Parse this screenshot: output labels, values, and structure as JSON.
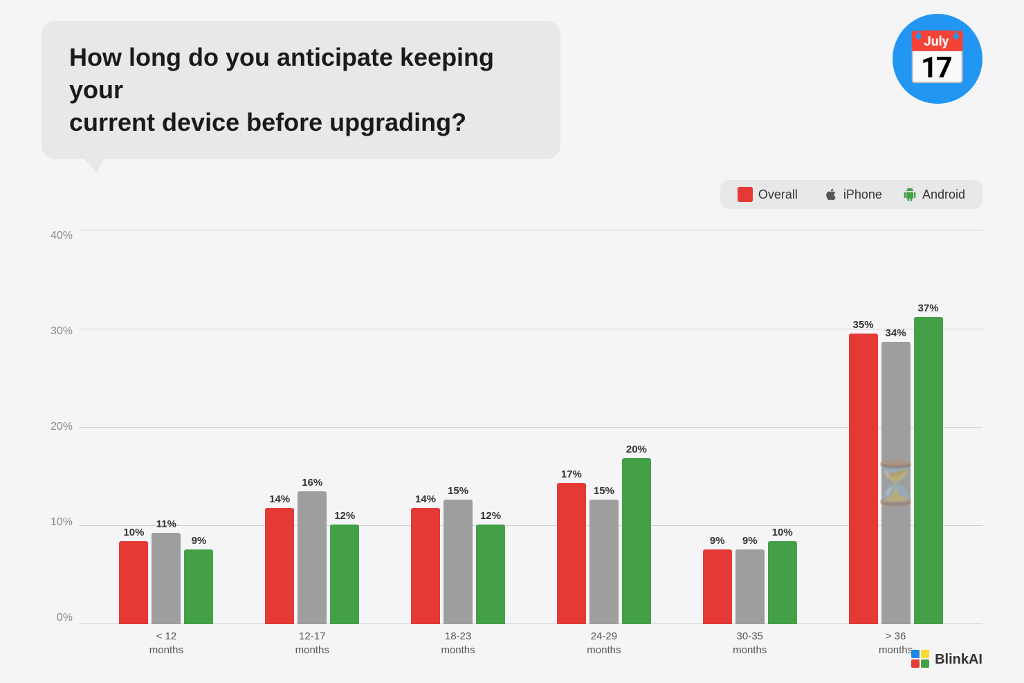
{
  "question": "How long do you anticipate keeping your\ncurrent device before upgrading?",
  "legend": {
    "items": [
      {
        "label": "Overall",
        "color": "#e53935",
        "icon": "square",
        "type": "color"
      },
      {
        "label": "iPhone",
        "color": "#9e9e9e",
        "icon": "apple",
        "type": "icon"
      },
      {
        "label": "Android",
        "color": "#43a047",
        "icon": "android",
        "type": "icon"
      }
    ]
  },
  "yAxis": {
    "labels": [
      "0%",
      "10%",
      "20%",
      "30%",
      "40%"
    ]
  },
  "chartTitle": "How long do you anticipate keeping your current device before upgrading?",
  "groups": [
    {
      "label": "< 12\nmonths",
      "bars": [
        {
          "value": 10,
          "label": "10%",
          "color": "red"
        },
        {
          "value": 11,
          "label": "11%",
          "color": "gray"
        },
        {
          "value": 9,
          "label": "9%",
          "color": "green"
        }
      ]
    },
    {
      "label": "12-17\nmonths",
      "bars": [
        {
          "value": 14,
          "label": "14%",
          "color": "red"
        },
        {
          "value": 16,
          "label": "16%",
          "color": "gray"
        },
        {
          "value": 12,
          "label": "12%",
          "color": "green"
        }
      ]
    },
    {
      "label": "18-23\nmonths",
      "bars": [
        {
          "value": 14,
          "label": "14%",
          "color": "red"
        },
        {
          "value": 15,
          "label": "15%",
          "color": "gray"
        },
        {
          "value": 12,
          "label": "12%",
          "color": "green"
        }
      ]
    },
    {
      "label": "24-29\nmonths",
      "bars": [
        {
          "value": 17,
          "label": "17%",
          "color": "red"
        },
        {
          "value": 15,
          "label": "15%",
          "color": "gray"
        },
        {
          "value": 20,
          "label": "20%",
          "color": "green"
        }
      ]
    },
    {
      "label": "30-35\nmonths",
      "bars": [
        {
          "value": 9,
          "label": "9%",
          "color": "red"
        },
        {
          "value": 9,
          "label": "9%",
          "color": "gray"
        },
        {
          "value": 10,
          "label": "10%",
          "color": "green"
        }
      ]
    },
    {
      "label": "> 36\nmonths",
      "bars": [
        {
          "value": 35,
          "label": "35%",
          "color": "red"
        },
        {
          "value": 34,
          "label": "34%",
          "color": "gray"
        },
        {
          "value": 37,
          "label": "37%",
          "color": "green"
        }
      ],
      "hasHourglass": true
    }
  ],
  "maxValue": 40,
  "branding": {
    "name": "BlinkAI",
    "logo": "blinkai"
  }
}
